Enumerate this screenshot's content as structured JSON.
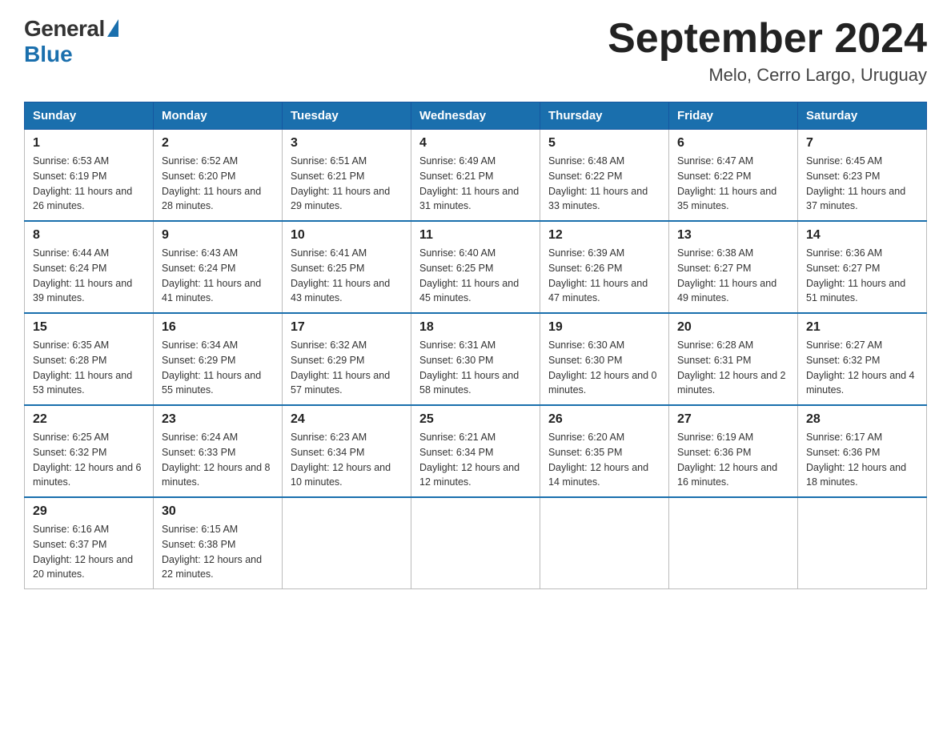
{
  "header": {
    "logo_general": "General",
    "logo_blue": "Blue",
    "month_year": "September 2024",
    "location": "Melo, Cerro Largo, Uruguay"
  },
  "days_of_week": [
    "Sunday",
    "Monday",
    "Tuesday",
    "Wednesday",
    "Thursday",
    "Friday",
    "Saturday"
  ],
  "weeks": [
    [
      {
        "day": "1",
        "sunrise": "Sunrise: 6:53 AM",
        "sunset": "Sunset: 6:19 PM",
        "daylight": "Daylight: 11 hours and 26 minutes."
      },
      {
        "day": "2",
        "sunrise": "Sunrise: 6:52 AM",
        "sunset": "Sunset: 6:20 PM",
        "daylight": "Daylight: 11 hours and 28 minutes."
      },
      {
        "day": "3",
        "sunrise": "Sunrise: 6:51 AM",
        "sunset": "Sunset: 6:21 PM",
        "daylight": "Daylight: 11 hours and 29 minutes."
      },
      {
        "day": "4",
        "sunrise": "Sunrise: 6:49 AM",
        "sunset": "Sunset: 6:21 PM",
        "daylight": "Daylight: 11 hours and 31 minutes."
      },
      {
        "day": "5",
        "sunrise": "Sunrise: 6:48 AM",
        "sunset": "Sunset: 6:22 PM",
        "daylight": "Daylight: 11 hours and 33 minutes."
      },
      {
        "day": "6",
        "sunrise": "Sunrise: 6:47 AM",
        "sunset": "Sunset: 6:22 PM",
        "daylight": "Daylight: 11 hours and 35 minutes."
      },
      {
        "day": "7",
        "sunrise": "Sunrise: 6:45 AM",
        "sunset": "Sunset: 6:23 PM",
        "daylight": "Daylight: 11 hours and 37 minutes."
      }
    ],
    [
      {
        "day": "8",
        "sunrise": "Sunrise: 6:44 AM",
        "sunset": "Sunset: 6:24 PM",
        "daylight": "Daylight: 11 hours and 39 minutes."
      },
      {
        "day": "9",
        "sunrise": "Sunrise: 6:43 AM",
        "sunset": "Sunset: 6:24 PM",
        "daylight": "Daylight: 11 hours and 41 minutes."
      },
      {
        "day": "10",
        "sunrise": "Sunrise: 6:41 AM",
        "sunset": "Sunset: 6:25 PM",
        "daylight": "Daylight: 11 hours and 43 minutes."
      },
      {
        "day": "11",
        "sunrise": "Sunrise: 6:40 AM",
        "sunset": "Sunset: 6:25 PM",
        "daylight": "Daylight: 11 hours and 45 minutes."
      },
      {
        "day": "12",
        "sunrise": "Sunrise: 6:39 AM",
        "sunset": "Sunset: 6:26 PM",
        "daylight": "Daylight: 11 hours and 47 minutes."
      },
      {
        "day": "13",
        "sunrise": "Sunrise: 6:38 AM",
        "sunset": "Sunset: 6:27 PM",
        "daylight": "Daylight: 11 hours and 49 minutes."
      },
      {
        "day": "14",
        "sunrise": "Sunrise: 6:36 AM",
        "sunset": "Sunset: 6:27 PM",
        "daylight": "Daylight: 11 hours and 51 minutes."
      }
    ],
    [
      {
        "day": "15",
        "sunrise": "Sunrise: 6:35 AM",
        "sunset": "Sunset: 6:28 PM",
        "daylight": "Daylight: 11 hours and 53 minutes."
      },
      {
        "day": "16",
        "sunrise": "Sunrise: 6:34 AM",
        "sunset": "Sunset: 6:29 PM",
        "daylight": "Daylight: 11 hours and 55 minutes."
      },
      {
        "day": "17",
        "sunrise": "Sunrise: 6:32 AM",
        "sunset": "Sunset: 6:29 PM",
        "daylight": "Daylight: 11 hours and 57 minutes."
      },
      {
        "day": "18",
        "sunrise": "Sunrise: 6:31 AM",
        "sunset": "Sunset: 6:30 PM",
        "daylight": "Daylight: 11 hours and 58 minutes."
      },
      {
        "day": "19",
        "sunrise": "Sunrise: 6:30 AM",
        "sunset": "Sunset: 6:30 PM",
        "daylight": "Daylight: 12 hours and 0 minutes."
      },
      {
        "day": "20",
        "sunrise": "Sunrise: 6:28 AM",
        "sunset": "Sunset: 6:31 PM",
        "daylight": "Daylight: 12 hours and 2 minutes."
      },
      {
        "day": "21",
        "sunrise": "Sunrise: 6:27 AM",
        "sunset": "Sunset: 6:32 PM",
        "daylight": "Daylight: 12 hours and 4 minutes."
      }
    ],
    [
      {
        "day": "22",
        "sunrise": "Sunrise: 6:25 AM",
        "sunset": "Sunset: 6:32 PM",
        "daylight": "Daylight: 12 hours and 6 minutes."
      },
      {
        "day": "23",
        "sunrise": "Sunrise: 6:24 AM",
        "sunset": "Sunset: 6:33 PM",
        "daylight": "Daylight: 12 hours and 8 minutes."
      },
      {
        "day": "24",
        "sunrise": "Sunrise: 6:23 AM",
        "sunset": "Sunset: 6:34 PM",
        "daylight": "Daylight: 12 hours and 10 minutes."
      },
      {
        "day": "25",
        "sunrise": "Sunrise: 6:21 AM",
        "sunset": "Sunset: 6:34 PM",
        "daylight": "Daylight: 12 hours and 12 minutes."
      },
      {
        "day": "26",
        "sunrise": "Sunrise: 6:20 AM",
        "sunset": "Sunset: 6:35 PM",
        "daylight": "Daylight: 12 hours and 14 minutes."
      },
      {
        "day": "27",
        "sunrise": "Sunrise: 6:19 AM",
        "sunset": "Sunset: 6:36 PM",
        "daylight": "Daylight: 12 hours and 16 minutes."
      },
      {
        "day": "28",
        "sunrise": "Sunrise: 6:17 AM",
        "sunset": "Sunset: 6:36 PM",
        "daylight": "Daylight: 12 hours and 18 minutes."
      }
    ],
    [
      {
        "day": "29",
        "sunrise": "Sunrise: 6:16 AM",
        "sunset": "Sunset: 6:37 PM",
        "daylight": "Daylight: 12 hours and 20 minutes."
      },
      {
        "day": "30",
        "sunrise": "Sunrise: 6:15 AM",
        "sunset": "Sunset: 6:38 PM",
        "daylight": "Daylight: 12 hours and 22 minutes."
      },
      null,
      null,
      null,
      null,
      null
    ]
  ]
}
